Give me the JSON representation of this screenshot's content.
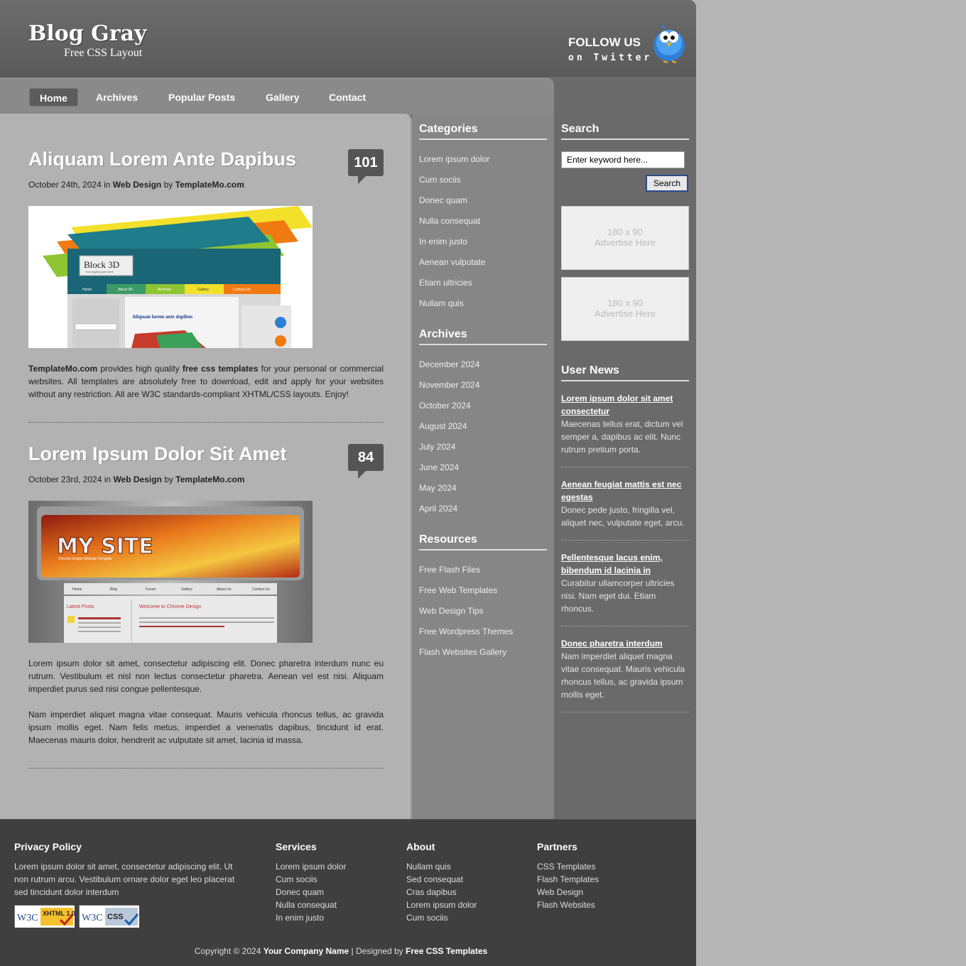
{
  "header": {
    "title": "Blog Gray",
    "subtitle": "Free CSS Layout",
    "follow_title": "FOLLOW US",
    "follow_sub": "on Twitter"
  },
  "nav": [
    "Home",
    "Archives",
    "Popular Posts",
    "Gallery",
    "Contact"
  ],
  "posts": [
    {
      "title": "Aliquam Lorem Ante Dapibus",
      "comments": "101",
      "date": "October 24th, 2024",
      "in_word": "in",
      "category": "Web Design",
      "by_word": "by",
      "author": "TemplateMo.com",
      "image_caption_title": "Block 3D",
      "image_caption_sub": "Your tagline goes here",
      "image_nav": [
        "Home",
        "About 3D",
        "Archives",
        "Gallery",
        "Contact Us"
      ],
      "image_post_title": "Aliquam lorem ante dapibus",
      "body_strong1": "TemplateMo.com",
      "body_text1": " provides high quality ",
      "body_strong2": "free css templates",
      "body_text2": " for your personal or commercial websites. All templates are absolutely free to download, edit and apply for your websites without any restriction. All are W3C standards-compliant XHTML/CSS layouts. Enjoy!"
    },
    {
      "title": "Lorem Ipsum Dolor Sit Amet",
      "comments": "84",
      "date": "October 23rd, 2024",
      "in_word": "in",
      "category": "Web Design",
      "by_word": "by",
      "author": "TemplateMo.com",
      "image_banner": "MY SITE",
      "image_banner_sub": "Chrome Design Website Template",
      "image_nav": [
        "Home",
        "Blog",
        "Forum",
        "Gallery",
        "About Us",
        "Contact Us"
      ],
      "image_left_title": "Latest Posts",
      "image_right_title": "Welcome to Chrome Design",
      "para1": "Lorem ipsum dolor sit amet, consectetur adipiscing elit. Donec pharetra interdum nunc eu rutrum. Vestibulum et nisl non lectus consectetur pharetra. Aenean vel est nisi. Aliquam imperdiet purus sed nisi congue pellentesque.",
      "para2": "Nam imperdiet aliquet magna vitae consequat. Mauris vehicula rhoncus tellus, ac gravida ipsum mollis eget. Nam felis metus, imperdiet a venenatis dapibus, tincidunt id erat. Maecenas mauris dolor, hendrerit ac vulputate sit amet, lacinia id massa."
    }
  ],
  "categories": {
    "title": "Categories",
    "items": [
      "Lorem ipsum dolor",
      "Cum sociis",
      "Donec quam",
      "Nulla consequat",
      "In enim justo",
      "Aenean vulputate",
      "Etiam ultricies",
      "Nullam quis"
    ]
  },
  "archives": {
    "title": "Archives",
    "items": [
      "December 2024",
      "November 2024",
      "October 2024",
      "August 2024",
      "July 2024",
      "June 2024",
      "May 2024",
      "April 2024"
    ]
  },
  "resources": {
    "title": "Resources",
    "items": [
      "Free Flash Files",
      "Free Web Templates",
      "Web Design Tips",
      "Free Wordpress Themes",
      "Flash Websites Gallery"
    ]
  },
  "search": {
    "title": "Search",
    "placeholder": "Enter keyword here...",
    "button": "Search"
  },
  "ads": [
    {
      "size": "180 x 90",
      "text": "Advertise Here"
    },
    {
      "size": "180 x 90",
      "text": "Advertise Here"
    }
  ],
  "user_news": {
    "title": "User News",
    "items": [
      {
        "title": "Lorem ipsum dolor sit amet consectetur",
        "body": "Maecenas tellus erat, dictum vel semper a, dapibus ac elit. Nunc rutrum pretium porta."
      },
      {
        "title": "Aenean feugiat mattis est nec egestas",
        "body": "Donec pede justo, fringilla vel, aliquet nec, vulputate eget, arcu."
      },
      {
        "title": "Pellentesque lacus enim, bibendum id lacinia in",
        "body": "Curabitur ullamcorper ultricies nisi. Nam eget dui. Etiam rhoncus."
      },
      {
        "title": "Donec pharetra interdum",
        "body": "Nam imperdiet aliquet magna vitae consequat. Mauris vehicula rhoncus tellus, ac gravida ipsum mollis eget."
      }
    ]
  },
  "footer": {
    "privacy_title": "Privacy Policy",
    "privacy_text": "Lorem ipsum dolor sit amet, consectetur adipiscing elit. Ut non rutrum arcu. Vestibulum ornare dolor eget leo placerat sed tincidunt dolor interdum",
    "services_title": "Services",
    "services": [
      "Lorem ipsum dolor",
      "Cum sociis",
      "Donec quam",
      "Nulla consequat",
      "In enim justo"
    ],
    "about_title": "About",
    "about": [
      "Nullam quis",
      "Sed consequat",
      "Cras dapibus",
      "Lorem ipsum dolor",
      "Cum sociis"
    ],
    "partners_title": "Partners",
    "partners": [
      "CSS Templates",
      "Flash Templates",
      "Web Design",
      "Flash Websites"
    ],
    "badge_xhtml": "XHTML 1.0",
    "badge_css": "CSS",
    "badge_w3c": "W3C",
    "copyright_pre": "Copyright © 2024 ",
    "company": "Your Company Name",
    "designed_by": " | Designed by ",
    "designer": "Free CSS Templates"
  },
  "colors": {
    "page_bg": "#b6b6b6",
    "header_bg": "#626262",
    "content_bg": "#b2b2b2",
    "sidebar_mid": "#868686",
    "sidebar_right": "#6a6a6a",
    "footer_bg": "#3f3f3f",
    "badge": "#555555"
  },
  "icons": {
    "twitter_bird": "bird-icon"
  }
}
